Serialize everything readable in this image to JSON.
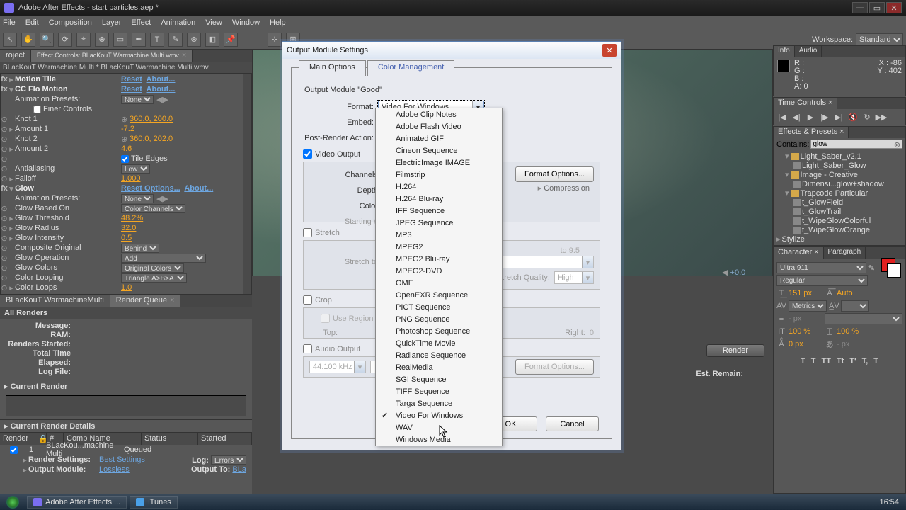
{
  "titlebar": {
    "icon": "ae-icon",
    "text": "Adobe After Effects - start particles.aep *"
  },
  "menu": [
    "File",
    "Edit",
    "Composition",
    "Layer",
    "Effect",
    "Animation",
    "View",
    "Window",
    "Help"
  ],
  "workspace": {
    "label": "Workspace:",
    "value": "Standard"
  },
  "left": {
    "project_tab": "roject",
    "fx_tab": "Effect Controls: BLacKouT Warmachine Multi.wmv",
    "fx_tab_x": "×",
    "subheader": "BLacKouT Warmachine Multi * BLacKouT Warmachine Multi.wmv",
    "motion_tile": {
      "name": "Motion Tile",
      "reset": "Reset",
      "about": "About..."
    },
    "ccflo": {
      "name": "CC Flo Motion",
      "reset": "Reset",
      "about": "About...",
      "presets_lbl": "Animation Presets:",
      "presets": "None",
      "finer": "Finer Controls",
      "knot1": "Knot 1",
      "knot1_v": "360.0, 200.0",
      "amount1": "Amount 1",
      "amount1_v": "-7.2",
      "knot2": "Knot 2",
      "knot2_v": "360.0, 202.0",
      "amount2": "Amount 2",
      "amount2_v": "4.6",
      "tile": "Tile Edges",
      "aa": "Antialiasing",
      "aa_v": "Low",
      "falloff": "Falloff",
      "falloff_v": "1.000"
    },
    "glow": {
      "name": "Glow",
      "reset": "Reset Options...",
      "about": "About...",
      "presets_lbl": "Animation Presets:",
      "presets": "None",
      "based": "Glow Based On",
      "based_v": "Color Channels",
      "thresh": "Glow Threshold",
      "thresh_v": "48.2%",
      "radius": "Glow Radius",
      "radius_v": "32.0",
      "intens": "Glow Intensity",
      "intens_v": "0.5",
      "comp": "Composite Original",
      "comp_v": "Behind",
      "op": "Glow Operation",
      "op_v": "Add",
      "colors": "Glow Colors",
      "colors_v": "Original Colors",
      "loop": "Color Looping",
      "loop_v": "Triangle A>B>A",
      "loops": "Color Loops",
      "loops_v": "1.0"
    },
    "tab_comp": "BLacKouT WarmachineMulti",
    "tab_rq": "Render Queue",
    "tab_rq_x": "×",
    "all_renders": "All Renders",
    "msg": "Message:",
    "ram": "RAM:",
    "started": "Renders Started:",
    "elapsed": "Total Time Elapsed:",
    "log": "Log File:",
    "current": "Current Render",
    "details": "Current Render Details",
    "hdr": {
      "render": "Render",
      "idx": "#",
      "comp": "Comp Name",
      "status": "Status",
      "started": "Started"
    },
    "row": {
      "idx": "1",
      "comp": "BLacKou...machine Multi",
      "status": "Queued"
    },
    "rs_lbl": "Render Settings:",
    "rs_v": "Best Settings",
    "log_lbl": "Log:",
    "log_v": "Errors",
    "om_lbl": "Output Module:",
    "om_v": "Lossless",
    "out_lbl": "Output To:",
    "out_v": "BLa"
  },
  "right": {
    "info": "Info",
    "audio": "Audio",
    "r": "R :",
    "g": "G :",
    "b": "B :",
    "a": "A: 0",
    "x": "X : -86",
    "y": "Y : 402",
    "timectrl": "Time Controls",
    "tc_x": "×",
    "fxp": "Effects & Presets",
    "fxp_x": "×",
    "contains": "Contains:",
    "search": "glow",
    "tree": [
      {
        "t": "folder",
        "l": "Light_Saber_v2.1",
        "i": 1
      },
      {
        "t": "preset",
        "l": "Light_Saber_Glow",
        "i": 2
      },
      {
        "t": "folder",
        "l": "Image - Creative",
        "i": 1
      },
      {
        "t": "preset",
        "l": "Dimensi...glow+shadow",
        "i": 2
      },
      {
        "t": "folder",
        "l": "Trapcode Particular",
        "i": 1
      },
      {
        "t": "preset",
        "l": "t_GlowField",
        "i": 2
      },
      {
        "t": "preset",
        "l": "t_GlowTrail",
        "i": 2
      },
      {
        "t": "preset",
        "l": "t_WipeGlowColorful",
        "i": 2
      },
      {
        "t": "preset",
        "l": "t_WipeGlowOrange",
        "i": 2
      },
      {
        "t": "text",
        "l": "Stylize",
        "i": 0
      }
    ],
    "char": "Character",
    "char_x": "×",
    "para": "Paragraph",
    "font": "Ultra 911",
    "style": "Regular",
    "size": "151 px",
    "lead": "Auto",
    "metrics": "Metrics",
    "va": "",
    "bl": "- px",
    "tsume": "",
    "vscale": "100 %",
    "hscale": "100 %",
    "bshift": "0 px",
    "stroke": "- px",
    "styles": [
      "T",
      "T",
      "TT",
      "Tt",
      "T'",
      "T,",
      "T"
    ]
  },
  "preview": {
    "zoom": "+0.0"
  },
  "render_button": "Render",
  "est_remain": "Est. Remain:",
  "dialog": {
    "title": "Output Module Settings",
    "tab_main": "Main Options",
    "tab_color": "Color Management",
    "module_lbl": "Output Module \"Good\"",
    "format_lbl": "Format:",
    "format_v": "Video For Windows",
    "embed_lbl": "Embed:",
    "post_lbl": "Post-Render Action:",
    "video": "Video Output",
    "fmt_opts": "Format Options...",
    "channels": "Channels:",
    "depth": "Depth:",
    "color": "Color:",
    "start": "Starting #:",
    "compression": "Compression",
    "stretch": "Stretch",
    "stretch_to": "Stretch to:",
    "sq": "Stretch Quality:",
    "sq_v": "High",
    "lock": "to 9:5",
    "crop": "Crop",
    "roi": "Use Region of Interest",
    "top": "Top:",
    "right_l": "Right:",
    "right_v": "0",
    "audio": "Audio Output",
    "audio_fmt": "Format Options...",
    "rate": "44.100 kHz",
    "ok": "OK",
    "cancel": "Cancel"
  },
  "formats": [
    "Adobe Clip Notes",
    "Adobe Flash Video",
    "Animated GIF",
    "Cineon Sequence",
    "ElectricImage IMAGE",
    "Filmstrip",
    "H.264",
    "H.264 Blu-ray",
    "IFF Sequence",
    "JPEG Sequence",
    "MP3",
    "MPEG2",
    "MPEG2 Blu-ray",
    "MPEG2-DVD",
    "OMF",
    "OpenEXR Sequence",
    "PICT Sequence",
    "PNG Sequence",
    "Photoshop Sequence",
    "QuickTime Movie",
    "Radiance Sequence",
    "RealMedia",
    "SGI Sequence",
    "TIFF Sequence",
    "Targa Sequence",
    "Video For Windows",
    "WAV",
    "Windows Media"
  ],
  "format_selected": "Video For Windows",
  "taskbar": {
    "items": [
      {
        "icon": "ae",
        "label": "Adobe After Effects ..."
      },
      {
        "icon": "itunes",
        "label": "iTunes"
      }
    ],
    "time": "16:54"
  }
}
